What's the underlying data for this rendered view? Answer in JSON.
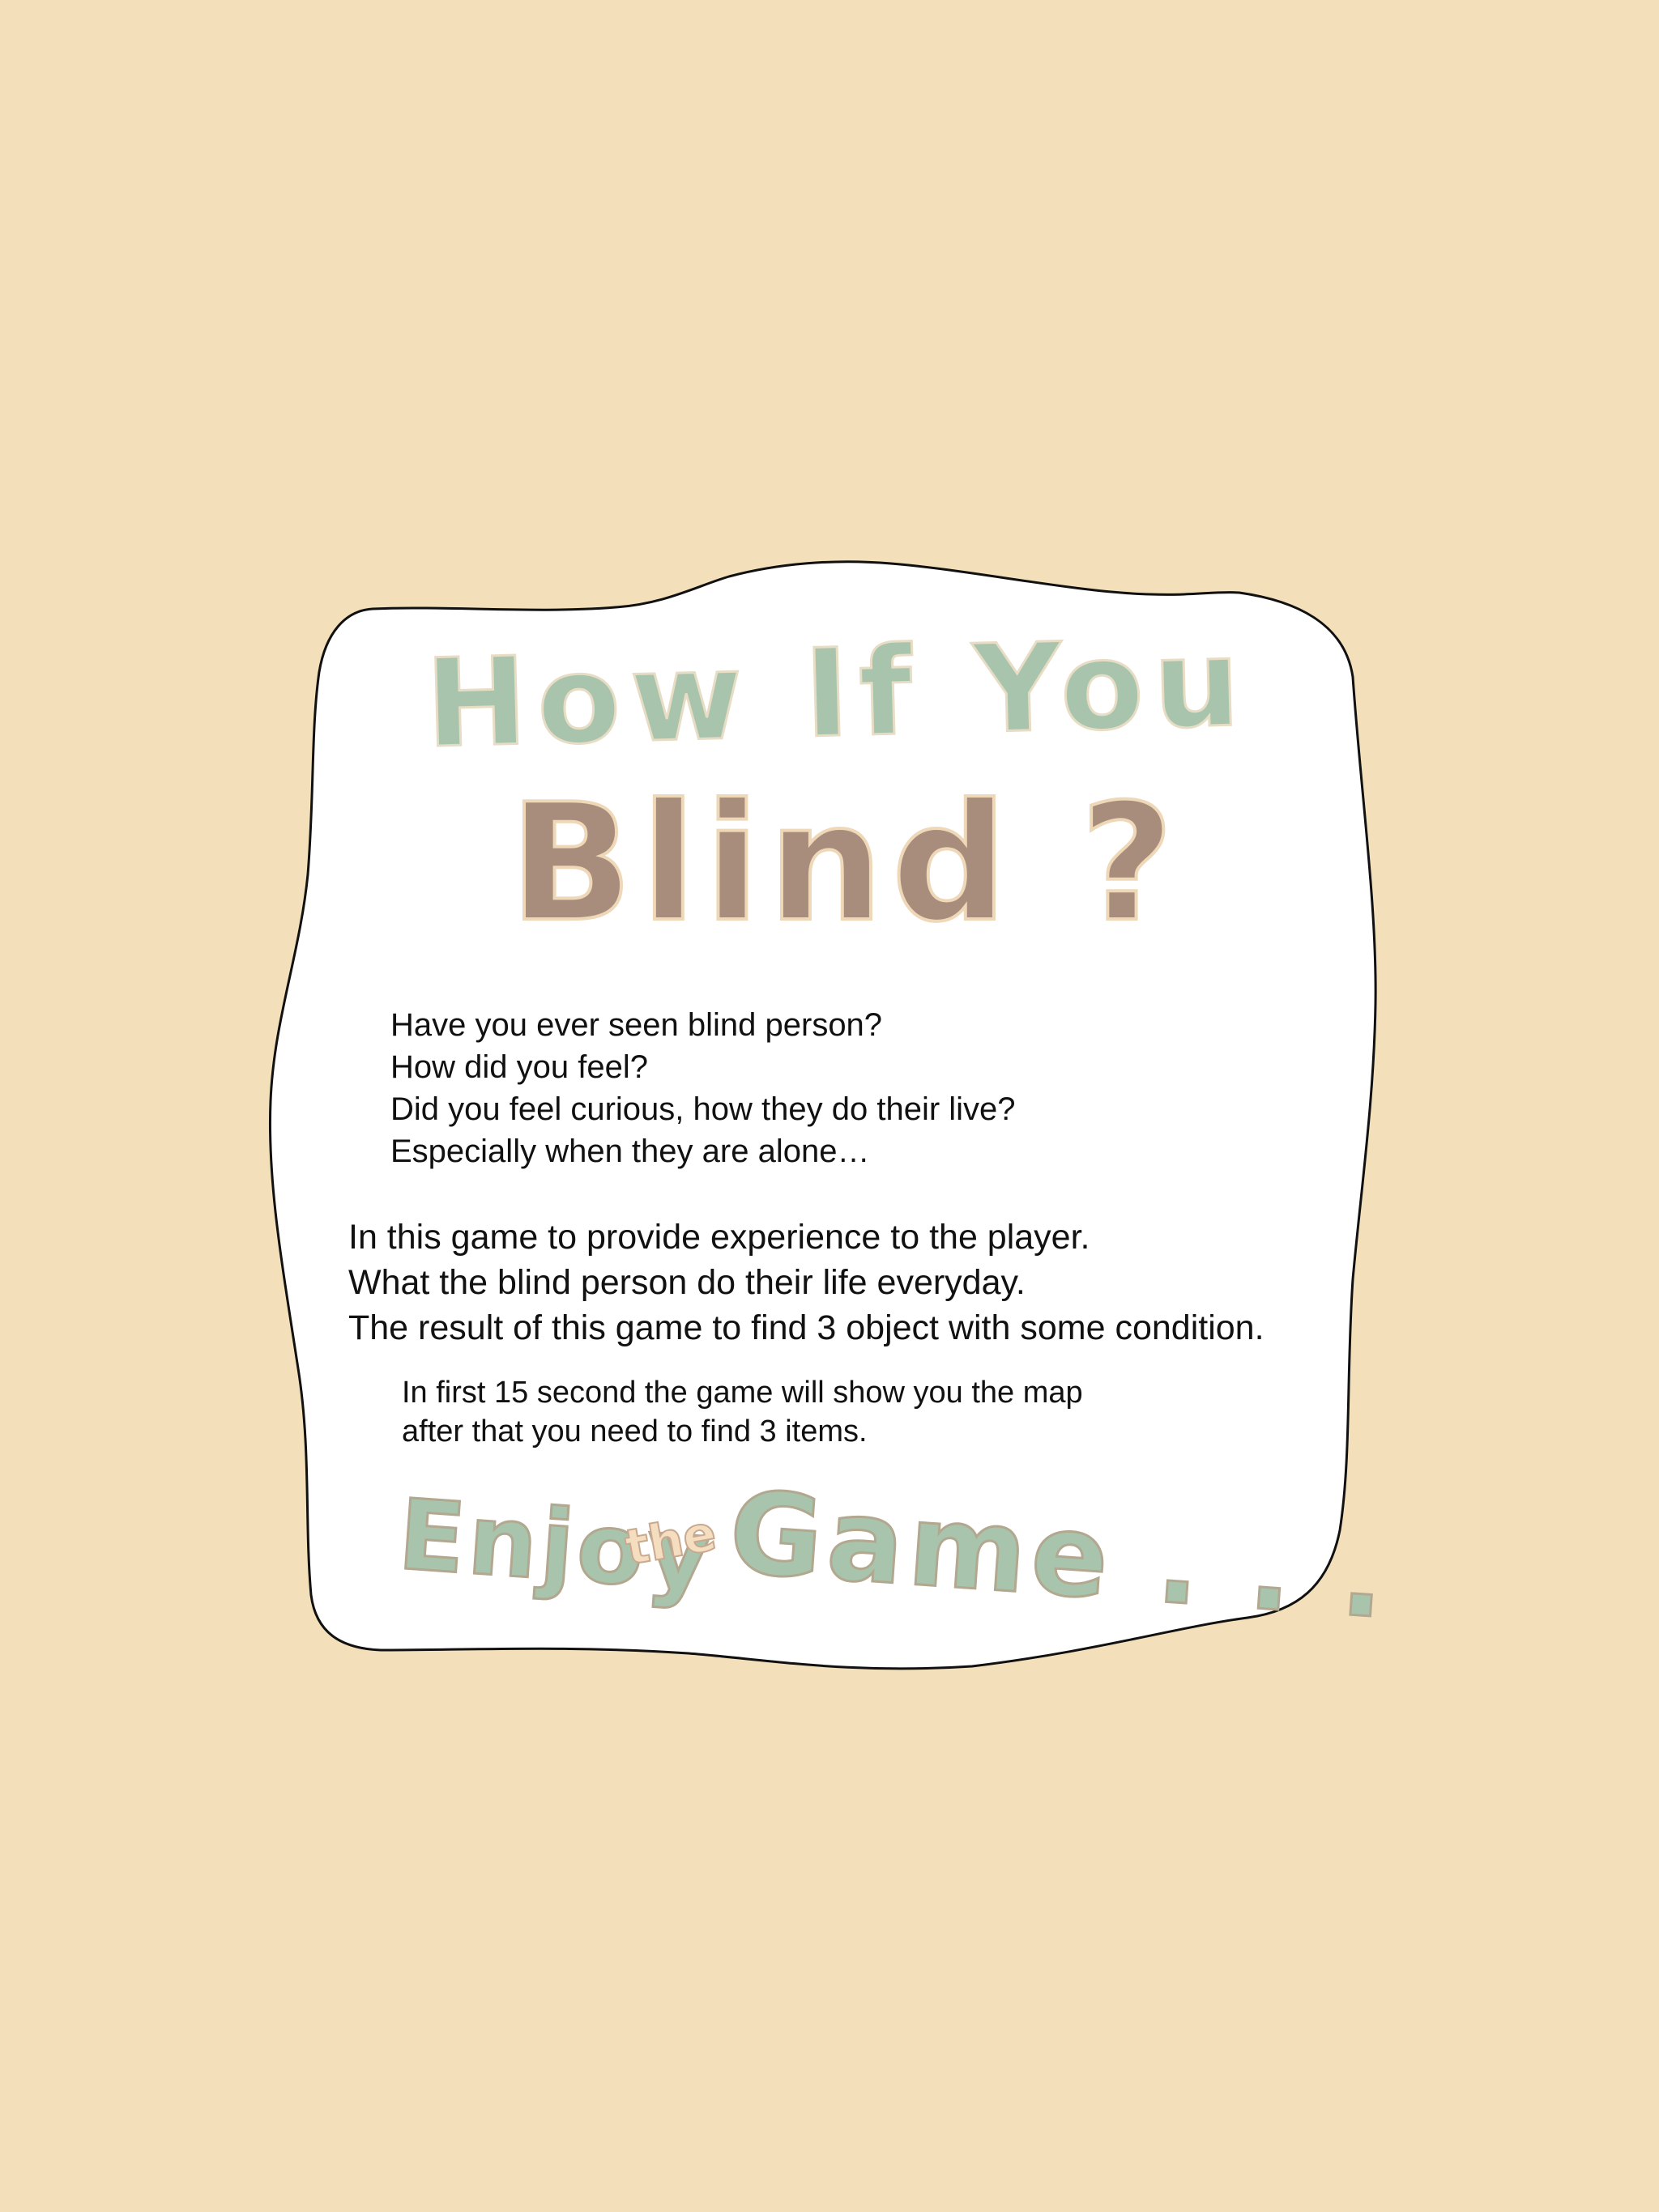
{
  "colors": {
    "background": "#f3e0bb",
    "card": "#ffffff",
    "card_border": "#111111",
    "title_green": "#a9c4ad",
    "title_brown": "#a88d7c",
    "accent_peach": "#f5ddc0"
  },
  "title": {
    "line1": "How If You",
    "line2": "Blind ?"
  },
  "intro_questions": [
    "Have you ever seen blind person?",
    "How did you feel?",
    "Did you feel curious, how they do their live?",
    "Especially when they are alone…"
  ],
  "description": [
    "In this game to provide experience to the player.",
    "What the blind person do their life everyday.",
    "The result of this game to find 3 object with some condition."
  ],
  "instructions": [
    "In first 15 second the game will show you the map",
    "after that you need to find 3 items."
  ],
  "footer": {
    "enjoy": "Enjoy",
    "the": "the",
    "game": "Game . . ."
  }
}
